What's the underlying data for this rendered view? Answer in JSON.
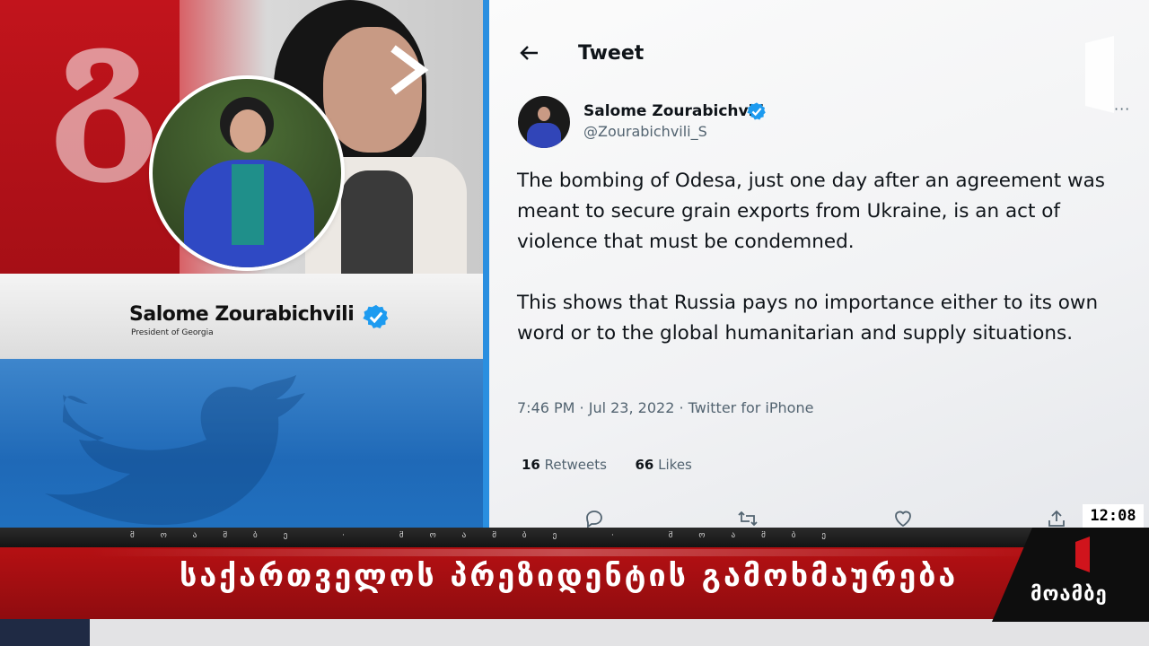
{
  "left_panel": {
    "name": "Salome Zourabichvili",
    "subtitle": "President of Georgia"
  },
  "tweet": {
    "header": "Tweet",
    "author_name": "Salome Zourabichvili",
    "author_handle": "@Zourabichvili_S",
    "paragraph_1": "The bombing of Odesa, just one day after an agreement was meant to secure grain exports from Ukraine, is an act of violence that must be condemned.",
    "paragraph_2": "This shows that Russia pays no importance either to its own word or to the global humanitarian and supply situations.",
    "meta": "7:46 PM · Jul 23, 2022 · Twitter for iPhone",
    "retweets_count": "16",
    "retweets_label": "Retweets",
    "likes_count": "66",
    "likes_label": "Likes",
    "more_label": "···"
  },
  "broadcast": {
    "clock": "12:08",
    "ticker": "მოამბე · მოამბე · მოამბე",
    "headline": "საქართველოს პრეზიდენტის გამოხმაურება",
    "channel_logo": "მოამბე"
  },
  "icons": {
    "back": "arrow-left-icon",
    "verified": "verified-badge-icon",
    "reply": "reply-icon",
    "retweet": "retweet-icon",
    "like": "heart-icon",
    "share": "share-icon",
    "chevron": "chevron-right-icon",
    "bird": "twitter-bird-icon"
  },
  "colors": {
    "twitter_blue": "#1d9bf0",
    "headline_red": "#b51013",
    "panel_blue": "#1f69b7"
  }
}
